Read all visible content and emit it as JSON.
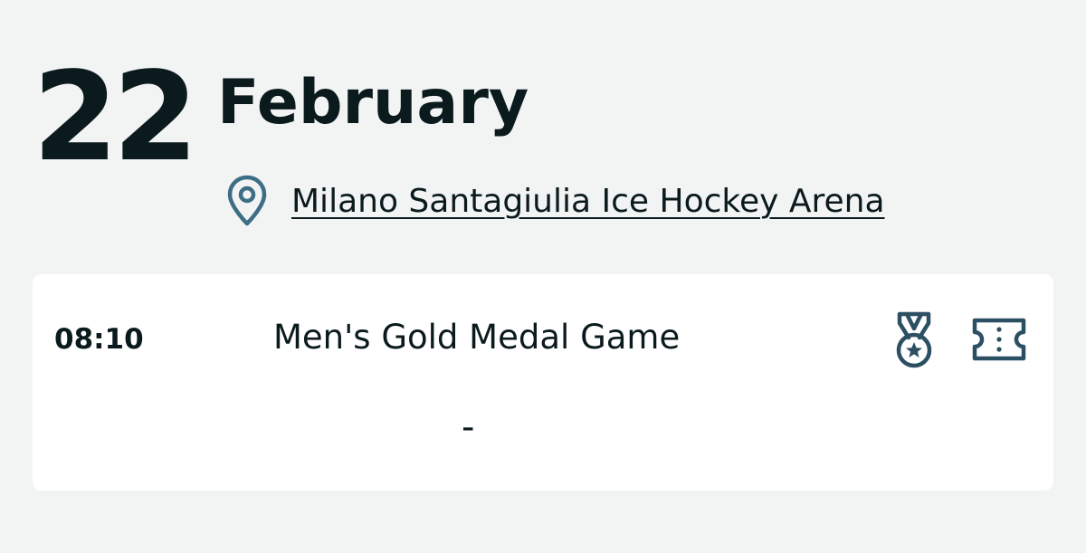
{
  "date": {
    "day": "22",
    "month": "February"
  },
  "venue": {
    "icon": "location-pin-icon",
    "name": "Milano Santagiulia Ice Hockey Arena"
  },
  "event": {
    "time": "08:10",
    "title": "Men's Gold Medal Game",
    "score": "-",
    "icons": [
      "medal-icon",
      "ticket-icon"
    ]
  },
  "colors": {
    "background": "#f2f4f4",
    "card": "#ffffff",
    "text": "#0b1a1d",
    "pin": "#3e6e86",
    "icon": "#2c4f63"
  }
}
